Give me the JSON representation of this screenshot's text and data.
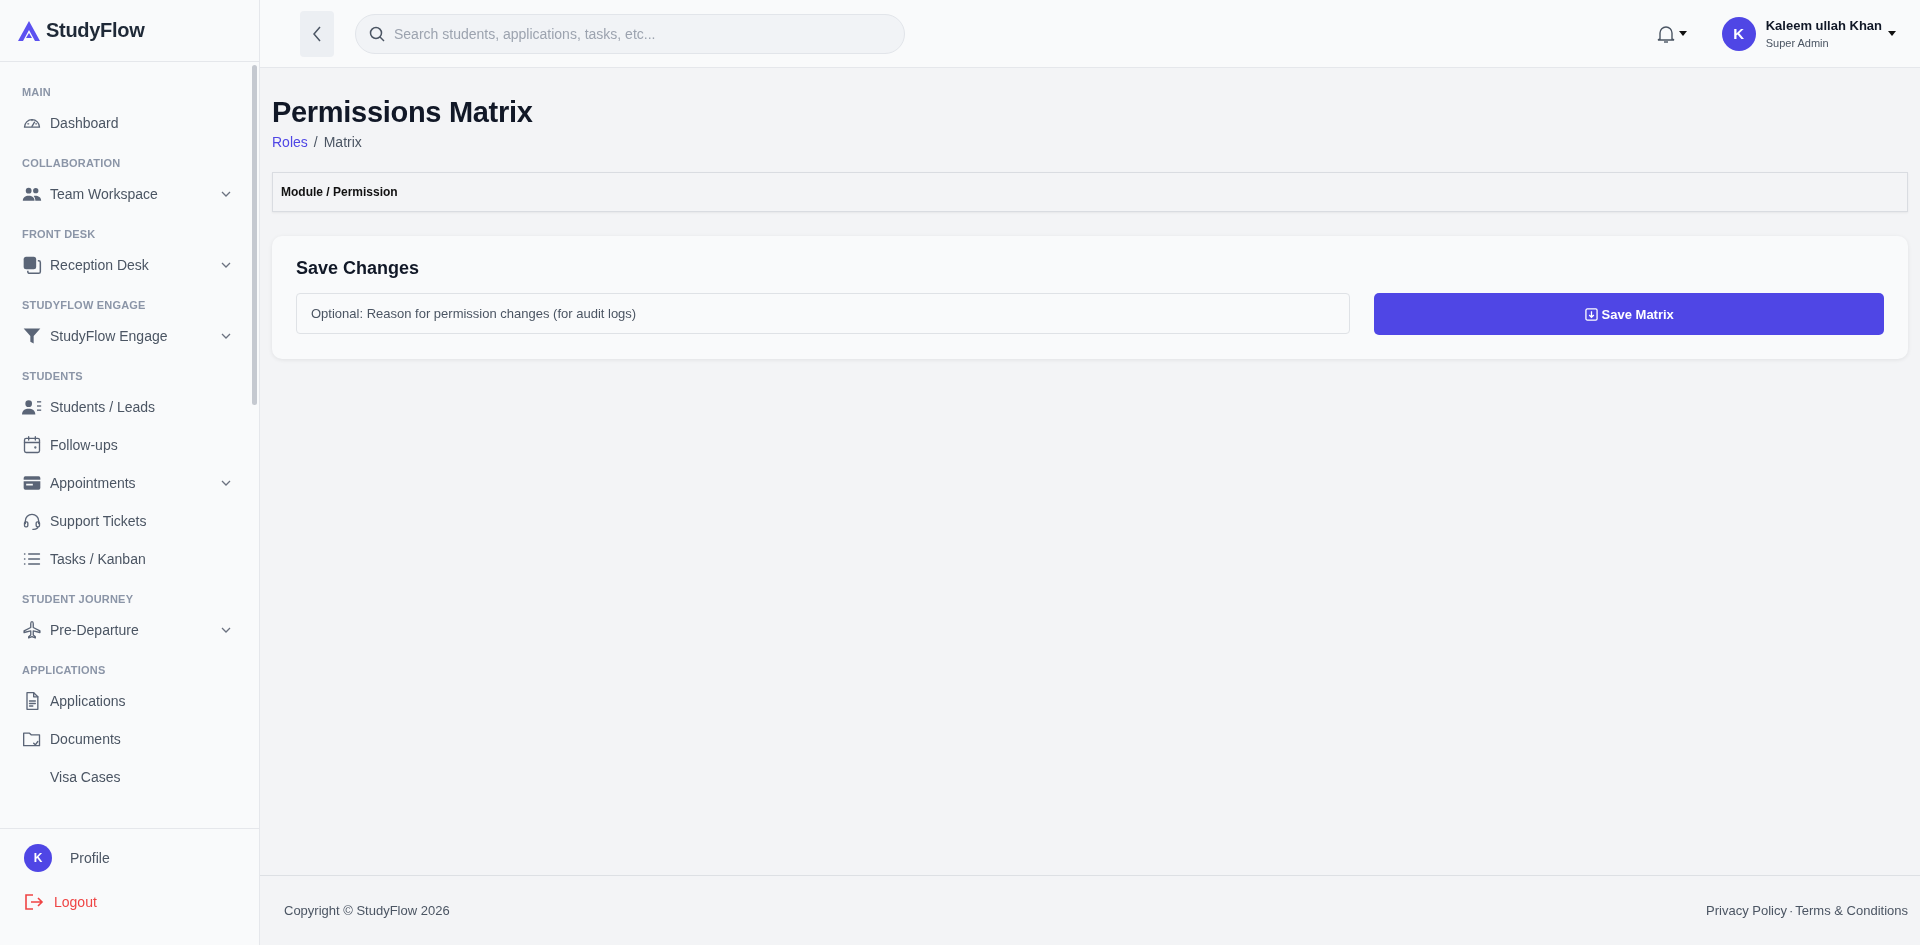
{
  "brand": {
    "name": "StudyFlow"
  },
  "sidebar": {
    "sections": [
      {
        "title": "MAIN",
        "items": [
          {
            "label": "Dashboard",
            "expandable": false
          }
        ]
      },
      {
        "title": "COLLABORATION",
        "items": [
          {
            "label": "Team Workspace",
            "expandable": true
          }
        ]
      },
      {
        "title": "FRONT DESK",
        "items": [
          {
            "label": "Reception Desk",
            "expandable": true
          }
        ]
      },
      {
        "title": "STUDYFLOW ENGAGE",
        "items": [
          {
            "label": "StudyFlow Engage",
            "expandable": true
          }
        ]
      },
      {
        "title": "STUDENTS",
        "items": [
          {
            "label": "Students / Leads",
            "expandable": false
          },
          {
            "label": "Follow-ups",
            "expandable": false
          },
          {
            "label": "Appointments",
            "expandable": true
          },
          {
            "label": "Support Tickets",
            "expandable": false
          },
          {
            "label": "Tasks / Kanban",
            "expandable": false
          }
        ]
      },
      {
        "title": "STUDENT JOURNEY",
        "items": [
          {
            "label": "Pre-Departure",
            "expandable": true
          }
        ]
      },
      {
        "title": "APPLICATIONS",
        "items": [
          {
            "label": "Applications",
            "expandable": false
          },
          {
            "label": "Documents",
            "expandable": false
          },
          {
            "label": "Visa Cases",
            "expandable": false
          }
        ]
      }
    ],
    "footer": {
      "avatar_letter": "K",
      "profile": "Profile",
      "logout": "Logout"
    }
  },
  "header": {
    "search": {
      "placeholder": "Search students, applications, tasks, etc..."
    },
    "user": {
      "avatar_letter": "K",
      "name": "Kaleem ullah Khan",
      "role": "Super Admin"
    }
  },
  "page": {
    "title": "Permissions Matrix",
    "breadcrumb_separator": "/",
    "breadcrumb": [
      {
        "label": "Roles",
        "link": true
      },
      {
        "label": "Matrix",
        "link": false
      }
    ],
    "table": {
      "columns": [
        "Module / Permission"
      ]
    },
    "save_card": {
      "title": "Save Changes",
      "reason": {
        "placeholder": "Optional: Reason for permission changes (for audit logs)"
      },
      "button": "Save Matrix"
    }
  },
  "footer": {
    "copyright": "Copyright © StudyFlow 2026",
    "links": [
      "Privacy Policy",
      "Terms & Conditions"
    ],
    "separator": "·"
  }
}
